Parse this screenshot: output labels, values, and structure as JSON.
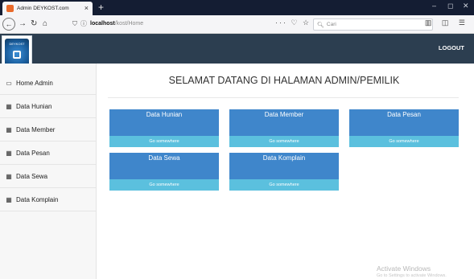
{
  "browser": {
    "tab_title": "Admin DEYKOST.com",
    "tab_close": "×",
    "new_tab": "+",
    "url_host": "localhost",
    "url_path": "/kost/Home",
    "url_info_icon": "ⓘ",
    "page_actions": "··· ♡ ☆",
    "search_placeholder": "Cari",
    "tool_icons": "▥ ◫ ☰",
    "window_controls": {
      "minimize": "–",
      "maximize": "◻",
      "close": "✕"
    }
  },
  "header": {
    "logo_text": "DEYKOST",
    "logout_label": "LOGOUT",
    "bg_color": "#2c3e50"
  },
  "sidebar": {
    "items": [
      {
        "label": "Home Admin",
        "icon": "monitor-icon",
        "glyph": "▭"
      },
      {
        "label": "Data Hunian",
        "icon": "table-icon",
        "glyph": "▦"
      },
      {
        "label": "Data Member",
        "icon": "table-icon",
        "glyph": "▦"
      },
      {
        "label": "Data Pesan",
        "icon": "table-icon",
        "glyph": "▦"
      },
      {
        "label": "Data Sewa",
        "icon": "table-icon",
        "glyph": "▦"
      },
      {
        "label": "Data Komplain",
        "icon": "table-icon",
        "glyph": "▦"
      }
    ]
  },
  "main": {
    "title": "SELAMAT DATANG DI HALAMAN ADMIN/PEMILIK",
    "cards": [
      {
        "label": "Data Hunian",
        "link": "Go somewhere"
      },
      {
        "label": "Data Member",
        "link": "Go somewhere"
      },
      {
        "label": "Data Pesan",
        "link": "Go somewhere"
      },
      {
        "label": "Data Sewa",
        "link": "Go somewhere"
      },
      {
        "label": "Data Komplain",
        "link": "Go somewhere"
      }
    ],
    "card_color": "#3f86cb",
    "link_color": "#5bc0de"
  },
  "watermark": {
    "line1": "Activate Windows",
    "line2": "Go to Settings to activate Windows."
  }
}
